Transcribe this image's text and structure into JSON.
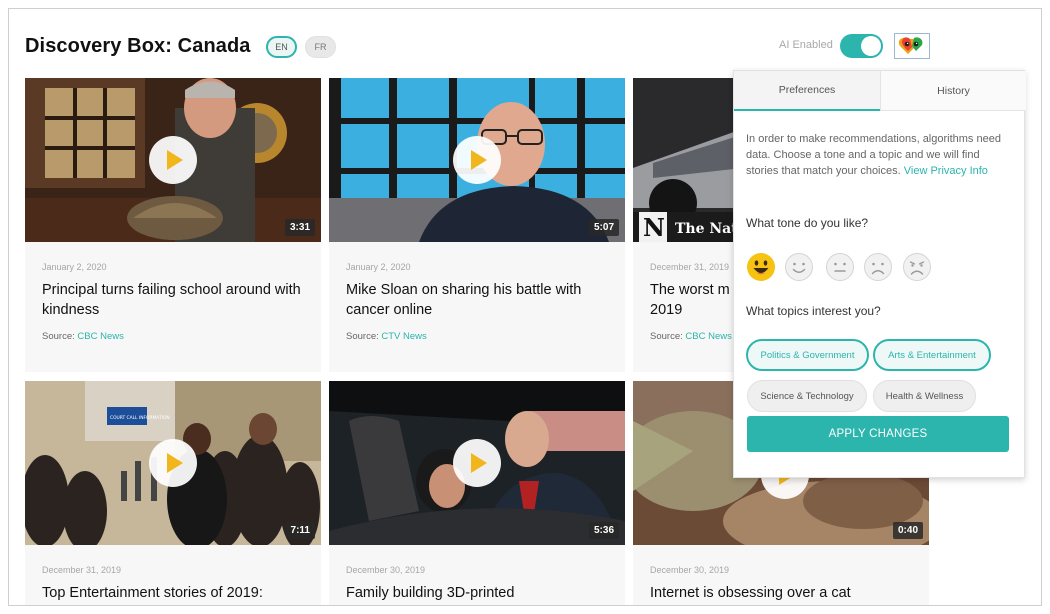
{
  "header": {
    "title": "Discovery Box: Canada",
    "languages": [
      {
        "label": "EN",
        "active": true
      },
      {
        "label": "FR",
        "active": false
      }
    ],
    "ai_label": "AI Enabled",
    "ai_enabled": true
  },
  "cards": [
    {
      "date": "January 2, 2020",
      "title": "Principal turns failing school around with kindness",
      "source_label": "Source:",
      "source": "CBC News",
      "duration": "3:31",
      "thumbnail_icon": "man-holding-tortoise-image"
    },
    {
      "date": "January 2, 2020",
      "title": "Mike Sloan on sharing his battle with cancer online",
      "source_label": "Source:",
      "source": "CTV News",
      "duration": "5:07",
      "thumbnail_icon": "bald-man-interview-image"
    },
    {
      "date": "December 31, 2019",
      "title": "The worst m 2019",
      "source_label": "Source:",
      "source": "CBC News",
      "duration": "",
      "thumbnail_icon": "cybertruck-image",
      "thumbnail_text": "The Nat"
    },
    {
      "date": "December 31, 2019",
      "title": "Top Entertainment stories of 2019:",
      "duration": "7:11",
      "thumbnail_icon": "press-crowd-image",
      "thumbnail_text": "COURT CALL INFORMATION"
    },
    {
      "date": "December 30, 2019",
      "title": "Family building 3D-printed",
      "duration": "5:36",
      "thumbnail_icon": "father-son-car-image"
    },
    {
      "date": "December 30, 2019",
      "title": "Internet is obsessing over a cat",
      "duration": "0:40",
      "thumbnail_icon": "baby-yoda-image"
    }
  ],
  "panel": {
    "tabs": [
      {
        "label": "Preferences",
        "active": true
      },
      {
        "label": "History",
        "active": false
      }
    ],
    "intro": "In order to make recommendations, algorithms need data. Choose a tone and a topic and we will find stories that match your choices.",
    "privacy_link": "View Privacy Info",
    "tone_question": "What tone do you like?",
    "tones": [
      {
        "icon": "very-happy-emoji-icon",
        "selected": true
      },
      {
        "icon": "happy-emoji-icon",
        "selected": false
      },
      {
        "icon": "neutral-emoji-icon",
        "selected": false
      },
      {
        "icon": "sad-emoji-icon",
        "selected": false
      },
      {
        "icon": "very-sad-emoji-icon",
        "selected": false
      }
    ],
    "topics_question": "What topics interest you?",
    "topics": [
      {
        "label": "Politics & Government",
        "selected": true
      },
      {
        "label": "Arts & Entertainment",
        "selected": true
      },
      {
        "label": "Science & Technology",
        "selected": false
      },
      {
        "label": "Health & Wellness",
        "selected": false
      }
    ],
    "apply_label": "APPLY CHANGES"
  },
  "colors": {
    "accent": "#2bb5ad",
    "play_icon": "#f2b61d",
    "emoji_selected": "#f7c313"
  }
}
